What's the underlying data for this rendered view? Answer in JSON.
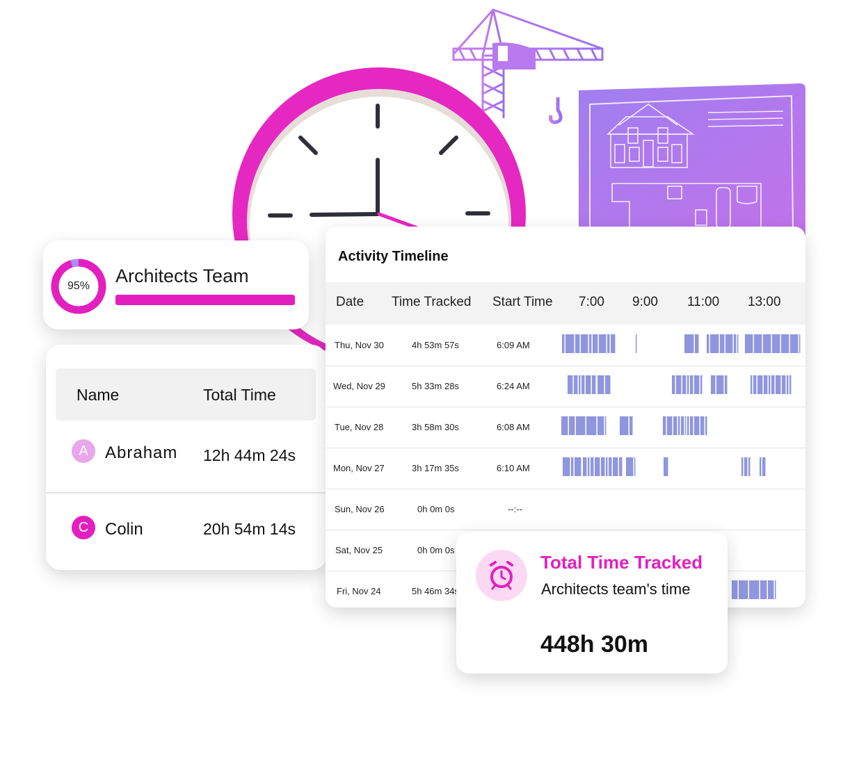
{
  "colors": {
    "accent": "#e31fbf",
    "bar": "#8f96dd",
    "purple": "#a97ded"
  },
  "team": {
    "name": "Architects Team",
    "percent_label": "95%",
    "percent": 0.95
  },
  "members": {
    "headers": {
      "name": "Name",
      "total": "Total Time"
    },
    "rows": [
      {
        "initial": "A",
        "name": "Abraham",
        "total": "12h 44m 24s",
        "avatar_color": "#e8a6ec"
      },
      {
        "initial": "C",
        "name": "Colin",
        "total": "20h 54m 14s",
        "avatar_color": "#e31fbf"
      }
    ]
  },
  "timeline": {
    "title": "Activity Timeline",
    "headers": {
      "date": "Date",
      "tracked": "Time Tracked",
      "start": "Start Time",
      "h7": "7:00",
      "h9": "9:00",
      "h11": "11:00",
      "h13": "13:00"
    },
    "rows": [
      {
        "date": "Thu, Nov 30",
        "tracked": "4h 53m 57s",
        "start": "6:09 AM"
      },
      {
        "date": "Wed, Nov 29",
        "tracked": "5h 33m 28s",
        "start": "6:24 AM"
      },
      {
        "date": "Tue, Nov 28",
        "tracked": "3h 58m 30s",
        "start": "6:08 AM"
      },
      {
        "date": "Mon, Nov 27",
        "tracked": "3h 17m 35s",
        "start": "6:10 AM"
      },
      {
        "date": "Sun, Nov 26",
        "tracked": "0h 0m 0s",
        "start": "--:--"
      },
      {
        "date": "Sat, Nov 25",
        "tracked": "0h 0m 0s",
        "start": ""
      },
      {
        "date": "Fri, Nov 24",
        "tracked": "5h 46m 34s",
        "start": ""
      }
    ]
  },
  "total": {
    "title": "Total Time Tracked",
    "subtitle": "Architects team's time",
    "value": "448h 30m",
    "icon": "alarm-clock-icon"
  },
  "illustration": {
    "clock_icon": "wall-clock-icon",
    "crane_icon": "construction-crane-icon",
    "blueprint_icon": "house-blueprint-icon"
  }
}
